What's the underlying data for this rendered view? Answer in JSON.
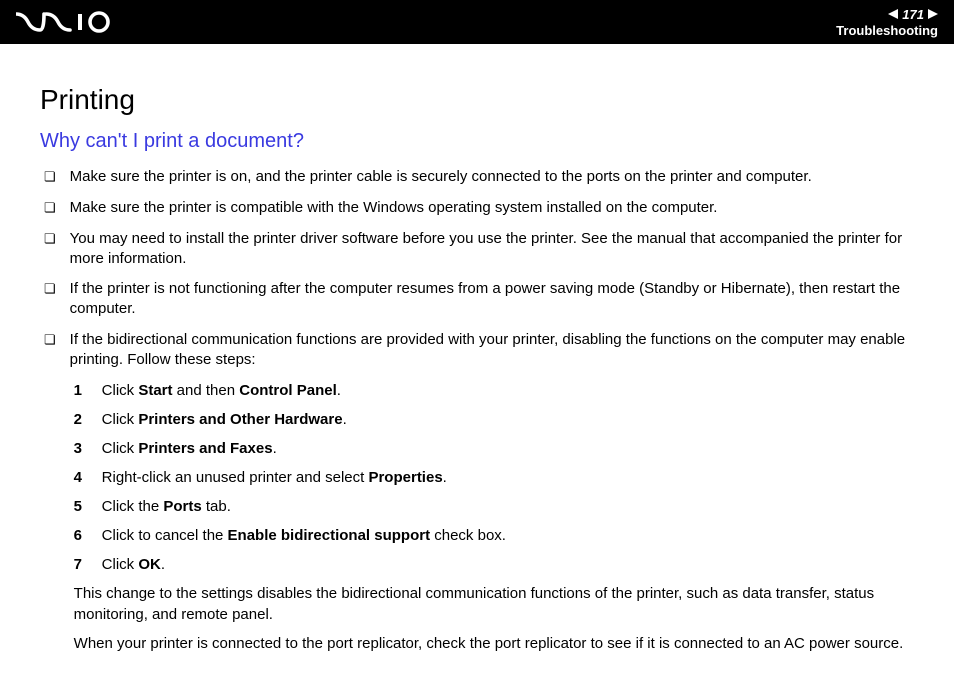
{
  "header": {
    "page_number": "171",
    "breadcrumb": "Troubleshooting"
  },
  "content": {
    "title": "Printing",
    "subheading": "Why can't I print a document?",
    "bullets": [
      "Make sure the printer is on, and the printer cable is securely connected to the ports on the printer and computer.",
      "Make sure the printer is compatible with the Windows operating system installed on the computer.",
      "You may need to install the printer driver software before you use the printer. See the manual that accompanied the printer for more information.",
      "If the printer is not functioning after the computer resumes from a power saving mode (Standby or Hibernate), then restart the computer.",
      "If the bidirectional communication functions are provided with your printer, disabling the functions on the computer may enable printing. Follow these steps:"
    ],
    "steps": [
      {
        "num": "1",
        "pre": "Click ",
        "bold1": "Start",
        "mid": " and then ",
        "bold2": "Control Panel",
        "post": "."
      },
      {
        "num": "2",
        "pre": "Click ",
        "bold1": "Printers and Other Hardware",
        "mid": "",
        "bold2": "",
        "post": "."
      },
      {
        "num": "3",
        "pre": "Click ",
        "bold1": "Printers and Faxes",
        "mid": "",
        "bold2": "",
        "post": "."
      },
      {
        "num": "4",
        "pre": "Right-click an unused printer and select ",
        "bold1": "Properties",
        "mid": "",
        "bold2": "",
        "post": "."
      },
      {
        "num": "5",
        "pre": "Click the ",
        "bold1": "Ports",
        "mid": "",
        "bold2": "",
        "post": " tab."
      },
      {
        "num": "6",
        "pre": "Click to cancel the ",
        "bold1": "Enable bidirectional support",
        "mid": "",
        "bold2": "",
        "post": " check box."
      },
      {
        "num": "7",
        "pre": "Click ",
        "bold1": "OK",
        "mid": "",
        "bold2": "",
        "post": "."
      }
    ],
    "note1": "This change to the settings disables the bidirectional communication functions of the printer, such as data transfer, status monitoring, and remote panel.",
    "note2": "When your printer is connected to the port replicator, check the port replicator to see if it is connected to an AC power source."
  }
}
